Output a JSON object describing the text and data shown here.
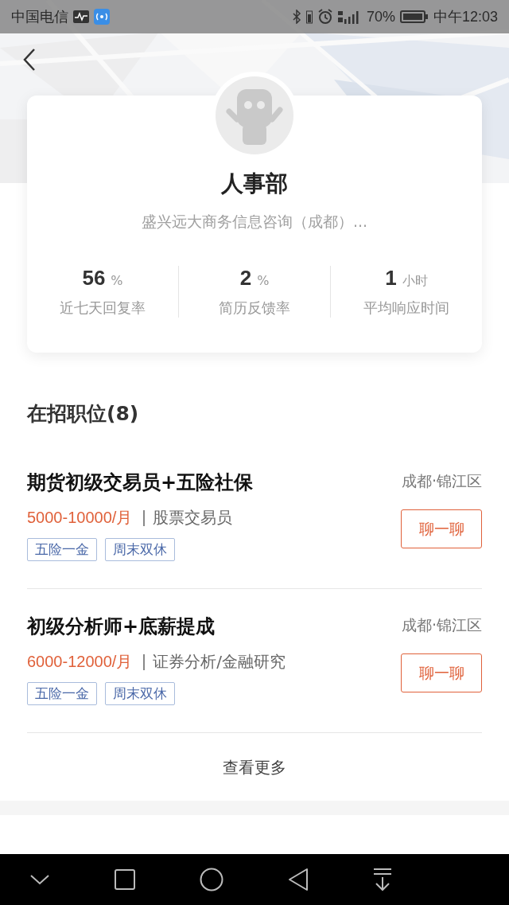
{
  "status_bar": {
    "carrier": "中国电信",
    "battery": "70%",
    "time": "中午12:03"
  },
  "recruiter": {
    "name": "人事部",
    "company": "盛兴远大商务信息咨询（成都）...",
    "stats": [
      {
        "value": "56",
        "unit": "%",
        "label": "近七天回复率"
      },
      {
        "value": "2",
        "unit": "%",
        "label": "简历反馈率"
      },
      {
        "value": "1",
        "unit": "小时",
        "label": "平均响应时间"
      }
    ]
  },
  "jobs_section": {
    "title": "在招职位(8)",
    "jobs": [
      {
        "title": "期货初级交易员+五险社保",
        "location": "成都·锦江区",
        "salary": "5000-10000/月",
        "category": "股票交易员",
        "tags": [
          "五险一金",
          "周末双休"
        ],
        "button": "聊一聊"
      },
      {
        "title": "初级分析师+底薪提成",
        "location": "成都·锦江区",
        "salary": "6000-12000/月",
        "category": "证券分析/金融研究",
        "tags": [
          "五险一金",
          "周末双休"
        ],
        "button": "聊一聊"
      }
    ],
    "more": "查看更多"
  }
}
